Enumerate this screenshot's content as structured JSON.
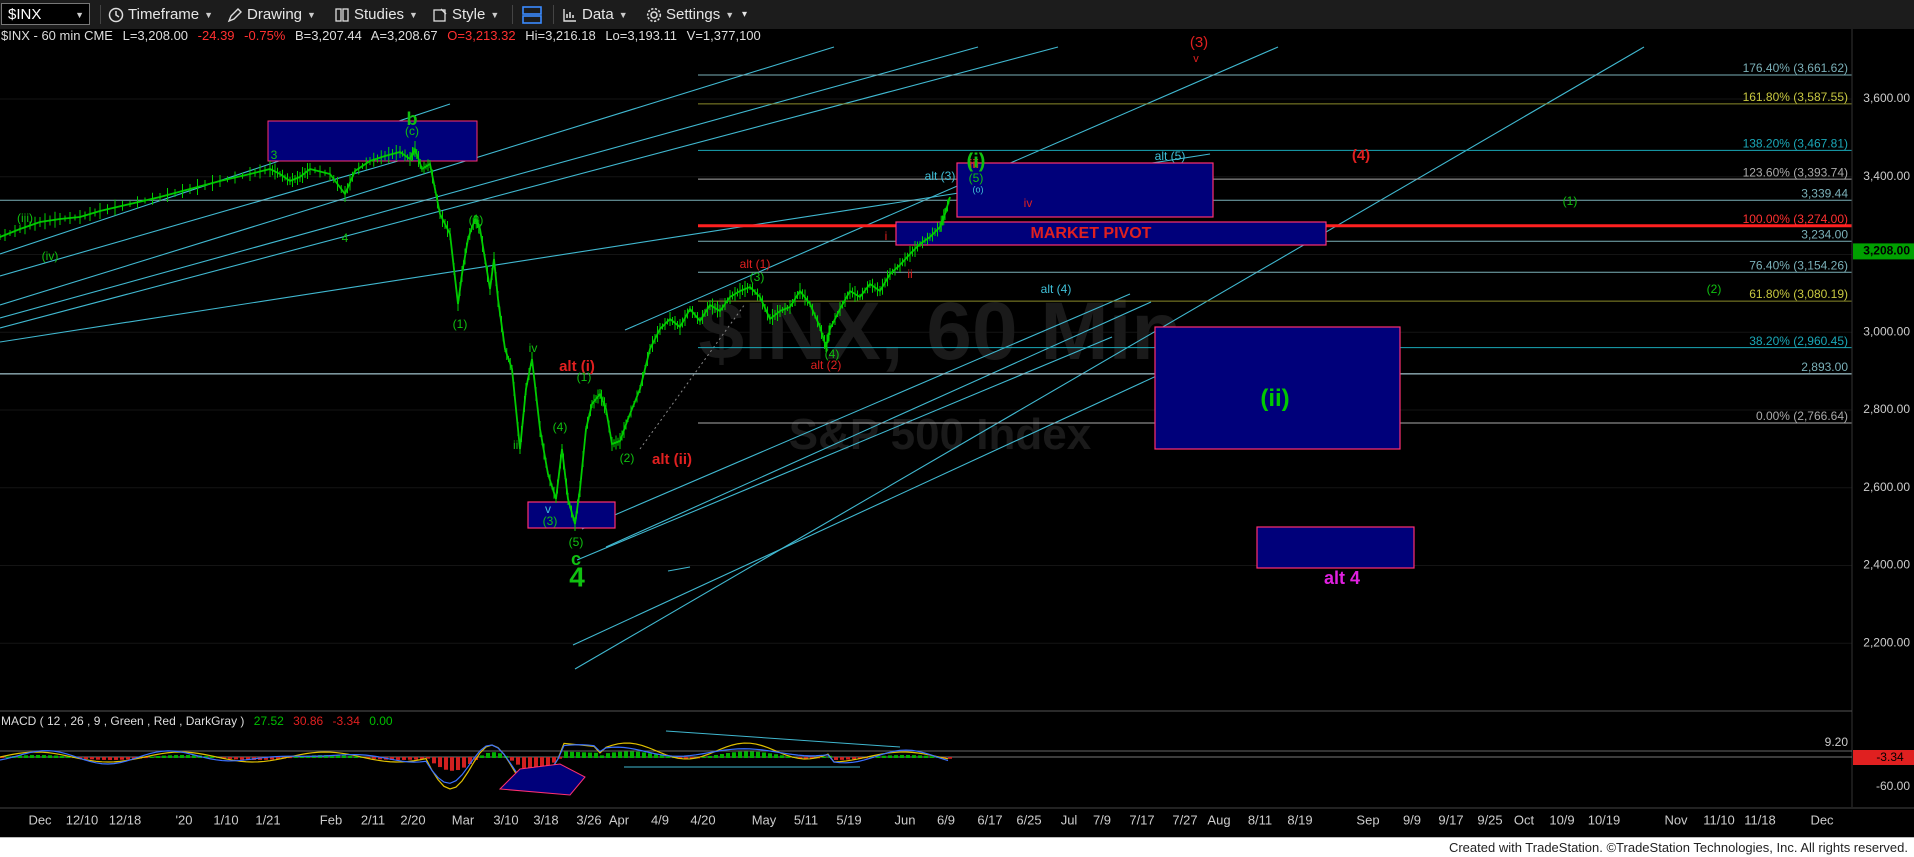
{
  "toolbar": {
    "symbol": "$INX",
    "timeframe": "Timeframe",
    "drawing": "Drawing",
    "studies": "Studies",
    "style": "Style",
    "data": "Data",
    "settings": "Settings"
  },
  "header": {
    "symbol_line": "$INX - 60 min  CME",
    "last": "L=3,208.00",
    "change": "-24.39",
    "pct": "-0.75%",
    "bid": "B=3,207.44",
    "ask": "A=3,208.67",
    "open": "O=3,213.32",
    "high": "Hi=3,216.18",
    "low": "Lo=3,193.11",
    "volume": "V=1,377,100"
  },
  "watermark": {
    "line1": "$INX, 60 Min",
    "line2": "S&P 500 Index"
  },
  "price_axis": {
    "labels": [
      "3,600.00",
      "3,400.00",
      "3,200.00",
      "3,000.00",
      "2,800.00",
      "2,600.00",
      "2,400.00",
      "2,200.00"
    ],
    "last_price": "3,208.00",
    "last_price_color": "#00a000"
  },
  "fib_levels": [
    {
      "text": "176.40% (3,661.62)",
      "price": 3661.62,
      "color": "#7ab0b8"
    },
    {
      "text": "161.80% (3,587.55)",
      "price": 3587.55,
      "color": "#8a8a2a"
    },
    {
      "text": "138.20% (3,467.81)",
      "price": 3467.81,
      "color": "#1aa8b8"
    },
    {
      "text": "123.60% (3,393.74)",
      "price": 3393.74,
      "color": "#aaaaaa"
    },
    {
      "text": "3,339.44",
      "price": 3339.44,
      "color": "#7ab0b8"
    },
    {
      "text": "100.00% (3,274.00)",
      "price": 3274.0,
      "color": "#ff2020"
    },
    {
      "text": "3,234.00",
      "price": 3234.0,
      "color": "#7ab0b8"
    },
    {
      "text": "76.40% (3,154.26)",
      "price": 3154.26,
      "color": "#7ab0b8"
    },
    {
      "text": "61.80% (3,080.19)",
      "price": 3080.19,
      "color": "#8a8a2a"
    },
    {
      "text": "38.20% (2,960.45)",
      "price": 2960.45,
      "color": "#1aa8b8"
    },
    {
      "text": "2,893.00",
      "price": 2893.0,
      "color": "#7ab0b8"
    },
    {
      "text": "0.00% (2,766.64)",
      "price": 2766.64,
      "color": "#aaaaaa"
    }
  ],
  "date_axis": [
    "Dec",
    "12/10",
    "12/18",
    "'20",
    "1/10",
    "1/21",
    "Feb",
    "2/11",
    "2/20",
    "Mar",
    "3/10",
    "3/18",
    "3/26",
    "Apr",
    "4/9",
    "4/20",
    "May",
    "5/11",
    "5/19",
    "Jun",
    "6/9",
    "6/17",
    "6/25",
    "Jul",
    "7/9",
    "7/17",
    "7/27",
    "Aug",
    "8/11",
    "8/19",
    "Sep",
    "9/9",
    "9/17",
    "9/25",
    "Oct",
    "10/9",
    "10/19",
    "Nov",
    "11/10",
    "11/18",
    "Dec"
  ],
  "boxes": {
    "market_pivot": "MARKET PIVOT",
    "wave_ii": "(ii)",
    "alt4": "alt 4"
  },
  "wave_labels": {
    "b": "b",
    "c_small": "(c)",
    "three": "3",
    "four": "4",
    "iii_paren": "(iii)",
    "iv_paren": "(iv)",
    "w1": "(1)",
    "w2": "(2)",
    "iv": "iv",
    "iii": "iii",
    "v": "v",
    "w3": "(3)",
    "w5": "(5)",
    "c": "c",
    "big4": "4",
    "alt_i": "alt (i)",
    "w1b": "(1)",
    "w4": "(4)",
    "w2b": "(2)",
    "alt_ii": "alt (ii)",
    "alt1": "alt (1)",
    "w3b": "(3)",
    "w4b": "(4)",
    "alt2": "alt (2)",
    "red_i": "i",
    "red_ii": "ii",
    "red_iii": "iii",
    "red_iv": "iv",
    "red_v": "v",
    "alt3": "alt (3)",
    "w5b": "(5)",
    "wave_i": "(i)",
    "small_o": "(o)",
    "alt5": "alt (5)",
    "alt4b": "alt (4)",
    "red3": "(3)",
    "red4": "(4)",
    "g1": "(1)",
    "g2": "(2)"
  },
  "macd": {
    "title": "MACD ( 12 , 26 , 9 , Green , Red , DarkGray )",
    "v1": "27.52",
    "v2": "30.86",
    "v3": "-3.34",
    "v4": "0.00",
    "axis_top": "9.20",
    "axis_mid": "-3.34",
    "axis_bot": "-60.00"
  },
  "footer": "Created with TradeStation. ©TradeStation Technologies, Inc. All rights reserved.",
  "colors": {
    "bg": "#000000",
    "price_green": "#00c800",
    "red": "#e02020",
    "cyan": "#40c0d8",
    "box_fill": "#000080",
    "box_border": "#ff3070",
    "magenta": "#e020e0"
  }
}
